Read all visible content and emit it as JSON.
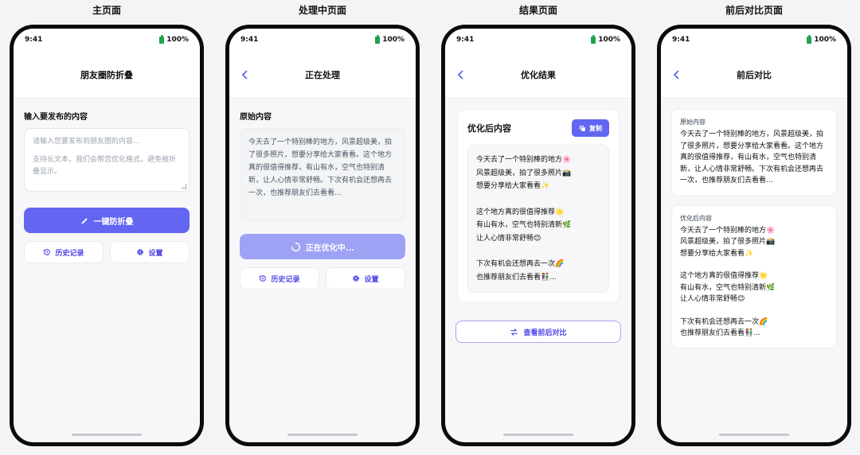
{
  "columns": {
    "home": "主页面",
    "processing": "处理中页面",
    "result": "结果页面",
    "compare": "前后对比页面"
  },
  "status": {
    "time": "9:41",
    "battery": "100%"
  },
  "home": {
    "nav_title": "朋友圈防折叠",
    "input_label": "输入要发布的内容",
    "placeholder_line1": "请输入您要发布到朋友圈的内容...",
    "placeholder_line2": "支持长文本，我们会帮您优化格式，避免被折叠显示。",
    "primary_button": "一键防折叠",
    "history_button": "历史记录",
    "settings_button": "设置"
  },
  "processing": {
    "nav_title": "正在处理",
    "original_label": "原始内容",
    "original_text": "今天去了一个特别棒的地方，风景超级美，拍了很多照片，想要分享给大家看看。这个地方真的很值得推荐，有山有水，空气也特别清新，让人心情非常舒畅。下次有机会还想再去一次，也推荐朋友们去看看...",
    "loading_button": "正在优化中...",
    "history_button": "历史记录",
    "settings_button": "设置"
  },
  "result": {
    "nav_title": "优化结果",
    "card_title": "优化后内容",
    "copy_button": "复制",
    "lines": [
      "今天去了一个特别棒的地方🌸",
      "风景超级美，拍了很多照片📸",
      "想要分享给大家看看✨",
      "",
      "这个地方真的很值得推荐🌟",
      "有山有水，空气也特别清新🌿",
      "让人心情非常舒畅😊",
      "",
      "下次有机会还想再去一次🌈",
      "也推荐朋友们去看看👫..."
    ],
    "compare_button": "查看前后对比"
  },
  "compare": {
    "nav_title": "前后对比",
    "original_label": "原始内容",
    "original_text": "今天去了一个特别棒的地方，风景超级美，拍了很多照片，想要分享给大家看看。这个地方真的很值得推荐，有山有水，空气也特别清新，让人心情非常舒畅。下次有机会还想再去一次，也推荐朋友们去看看...",
    "optimized_label": "优化后内容",
    "lines": [
      "今天去了一个特别棒的地方🌸",
      "风景超级美，拍了很多照片📸",
      "想要分享给大家看看✨",
      "",
      "这个地方真的很值得推荐🌟",
      "有山有水，空气也特别清新🌿",
      "让人心情非常舒畅😊",
      "",
      "下次有机会还想再去一次🌈",
      "也推荐朋友们去看看👫..."
    ]
  }
}
